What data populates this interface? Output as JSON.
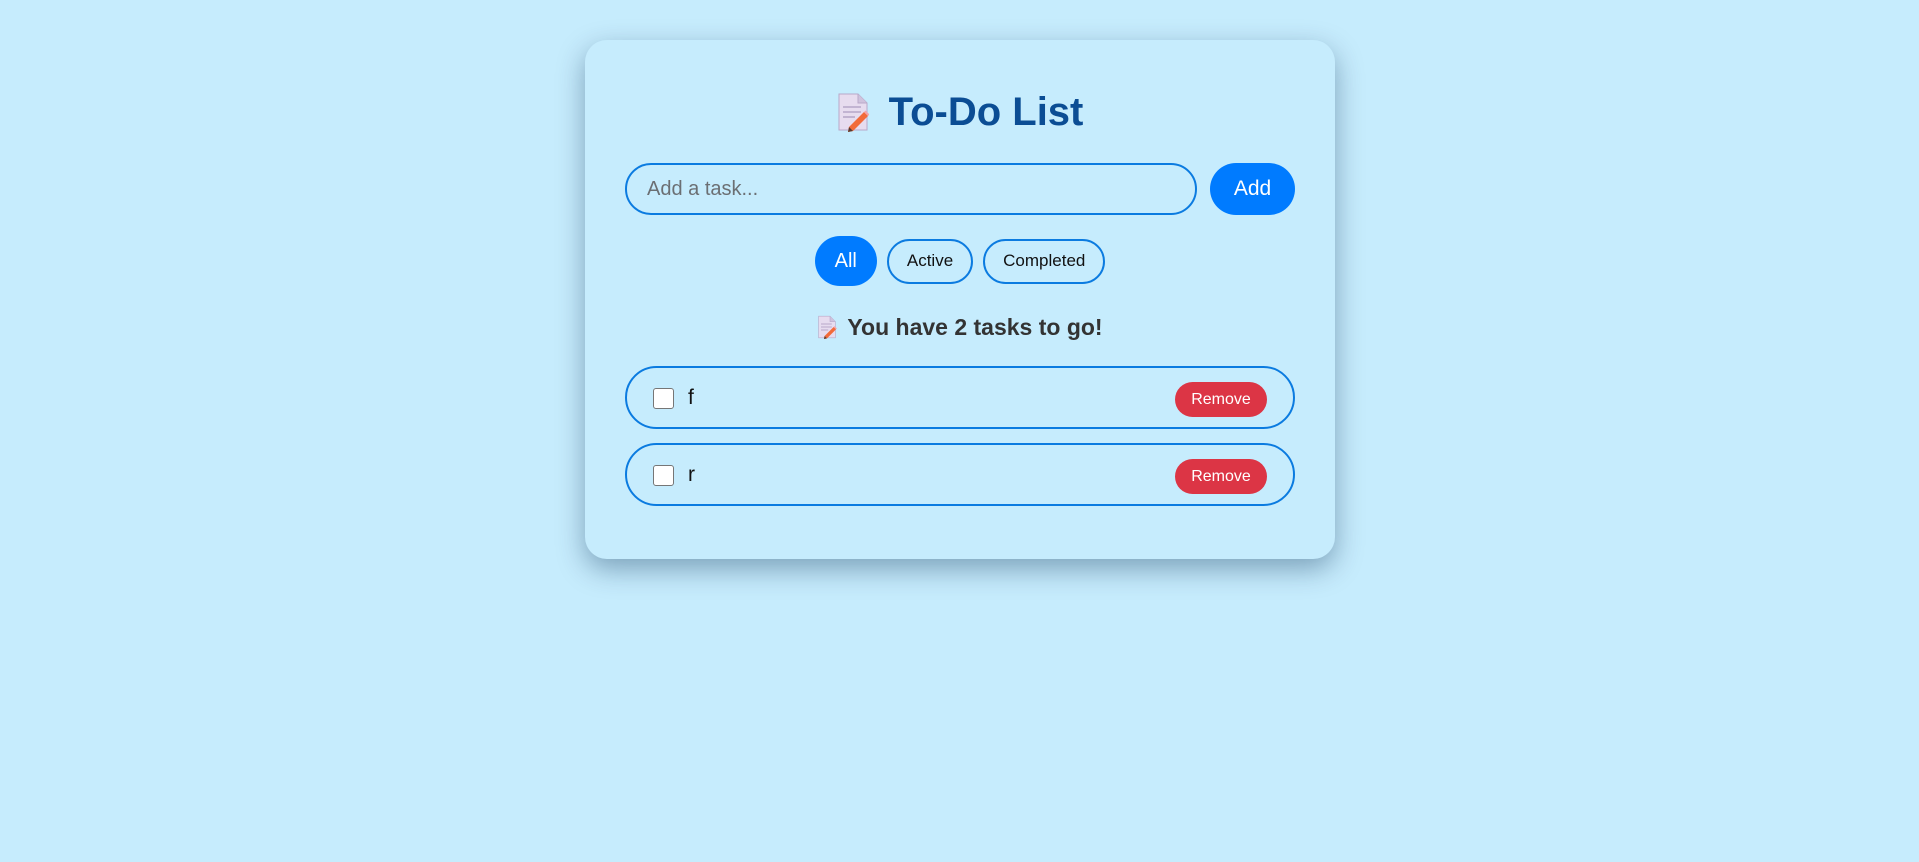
{
  "app": {
    "title": "To-Do List",
    "title_icon": "memo-icon"
  },
  "input": {
    "placeholder": "Add a task...",
    "value": "",
    "add_label": "Add"
  },
  "filters": [
    {
      "label": "All",
      "active": true
    },
    {
      "label": "Active",
      "active": false
    },
    {
      "label": "Completed",
      "active": false
    }
  ],
  "counter": {
    "icon": "memo-icon",
    "text": "You have 2 tasks to go!"
  },
  "tasks": [
    {
      "text": "f",
      "completed": false,
      "remove_label": "Remove"
    },
    {
      "text": "r",
      "completed": false,
      "remove_label": "Remove"
    }
  ],
  "colors": {
    "background": "#c6ecfd",
    "accent": "#007bff",
    "title": "#0b4d94",
    "danger": "#dc3545",
    "border": "#0b7be0"
  }
}
